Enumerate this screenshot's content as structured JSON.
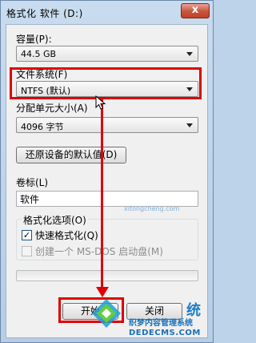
{
  "window": {
    "title": "格式化 软件 (D:)",
    "close_label": "x"
  },
  "capacity": {
    "label": "容量(P):",
    "value": "44.5 GB"
  },
  "filesystem": {
    "label": "文件系统(F)",
    "value": "NTFS (默认)"
  },
  "allocation": {
    "label": "分配单元大小(A)",
    "value": "4096 字节"
  },
  "restore_defaults_label": "还原设备的默认值(D)",
  "volume": {
    "label": "卷标(L)",
    "value": "软件"
  },
  "format_options": {
    "title": "格式化选项(O)",
    "quick_format": {
      "label": "快速格式化(Q)",
      "checked": true
    },
    "msdos_boot": {
      "label": "创建一个 MS-DOS 启动盘(M)",
      "checked": false,
      "enabled": false
    }
  },
  "progress": {
    "fraction": 0
  },
  "buttons": {
    "start": "开始",
    "close": "关闭"
  },
  "watermark": {
    "site_top": "xitongcheng.com",
    "brand": "织梦内容管理系统",
    "domain": "DEDECMS.COM",
    "partial": "统"
  },
  "colors": {
    "annotation_red": "#e00000",
    "dialog_bg": "#f0f0f0",
    "title_bar": "#c0d6ec"
  }
}
